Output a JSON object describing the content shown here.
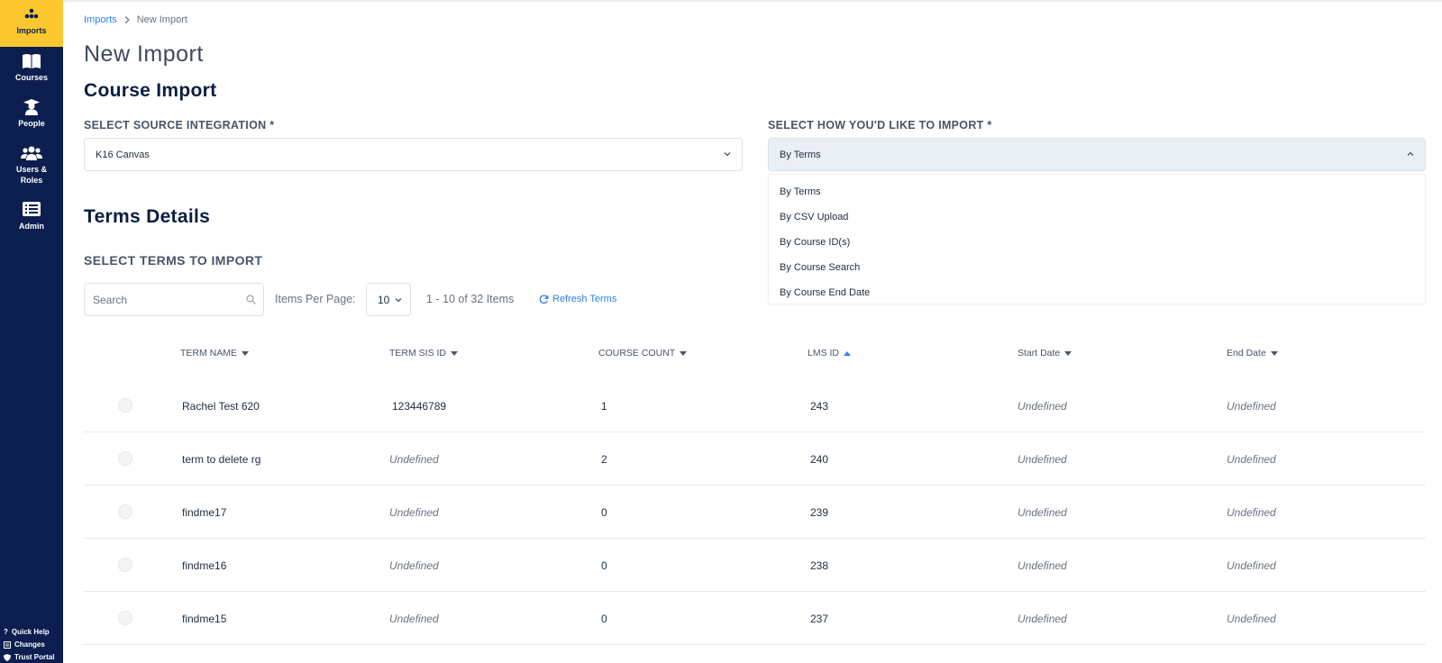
{
  "sidebar": {
    "items": [
      {
        "label": "Imports",
        "icon": "imports-icon"
      },
      {
        "label": "Courses",
        "icon": "book-icon"
      },
      {
        "label": "People",
        "icon": "graduate-icon"
      },
      {
        "label": "Users &",
        "label2": "Roles",
        "icon": "users-icon"
      },
      {
        "label": "Admin",
        "icon": "list-icon"
      }
    ],
    "bottom": [
      {
        "label": "Quick Help",
        "icon": "question-icon"
      },
      {
        "label": "Changes",
        "icon": "changes-icon"
      },
      {
        "label": "Trust Portal",
        "icon": "shield-icon"
      }
    ],
    "colors": {
      "background": "#0b1e4f",
      "active": "#fdc82f"
    }
  },
  "breadcrumb": {
    "root": "Imports",
    "current": "New Import"
  },
  "page_title": "New Import",
  "course_import": {
    "title": "Course Import",
    "source_label": "SELECT SOURCE INTEGRATION *",
    "source_value": "K16 Canvas",
    "method_label": "SELECT HOW YOU'D LIKE TO IMPORT *",
    "method_value": "By Terms",
    "method_options": [
      "By Terms",
      "By CSV Upload",
      "By Course ID(s)",
      "By Course Search",
      "By Course End Date"
    ]
  },
  "terms": {
    "title": "Terms Details",
    "select_label": "SELECT TERMS TO IMPORT",
    "search_placeholder": "Search",
    "items_per_page_label": "Items Per Page:",
    "items_per_page_value": "10",
    "range_text": "1 - 10 of 32 Items",
    "refresh_label": "Refresh Terms",
    "columns": [
      "TERM NAME",
      "TERM SIS ID",
      "COURSE COUNT",
      "LMS ID",
      "Start Date",
      "End Date"
    ],
    "sorted_column": "LMS ID",
    "rows": [
      {
        "name": "Rachel Test 620",
        "sis_id": "123446789",
        "course_count": "1",
        "lms_id": "243",
        "start": "Undefined",
        "end": "Undefined"
      },
      {
        "name": "term to delete rg",
        "sis_id": "Undefined",
        "course_count": "2",
        "lms_id": "240",
        "start": "Undefined",
        "end": "Undefined"
      },
      {
        "name": "findme17",
        "sis_id": "Undefined",
        "course_count": "0",
        "lms_id": "239",
        "start": "Undefined",
        "end": "Undefined"
      },
      {
        "name": "findme16",
        "sis_id": "Undefined",
        "course_count": "0",
        "lms_id": "238",
        "start": "Undefined",
        "end": "Undefined"
      },
      {
        "name": "findme15",
        "sis_id": "Undefined",
        "course_count": "0",
        "lms_id": "237",
        "start": "Undefined",
        "end": "Undefined"
      }
    ]
  },
  "accent_color": "#2f80ed"
}
